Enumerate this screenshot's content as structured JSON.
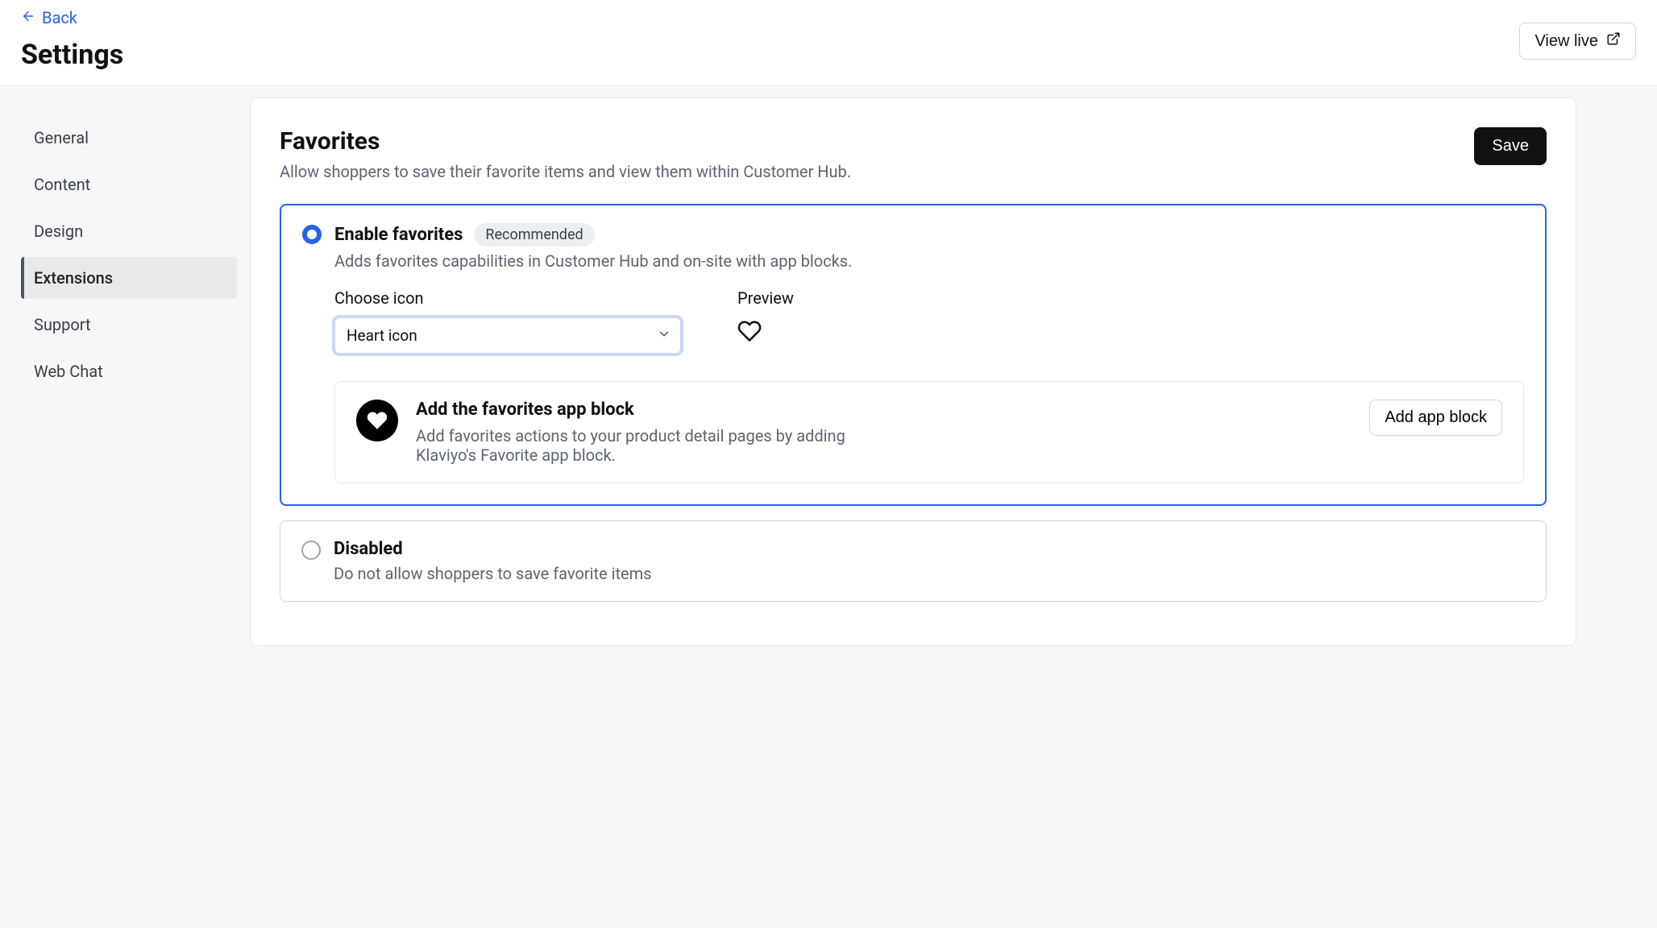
{
  "header": {
    "back_label": "Back",
    "page_title": "Settings",
    "view_live_label": "View live"
  },
  "sidebar": {
    "items": [
      {
        "label": "General",
        "active": false
      },
      {
        "label": "Content",
        "active": false
      },
      {
        "label": "Design",
        "active": false
      },
      {
        "label": "Extensions",
        "active": true
      },
      {
        "label": "Support",
        "active": false
      },
      {
        "label": "Web Chat",
        "active": false
      }
    ]
  },
  "section": {
    "title": "Favorites",
    "subtitle": "Allow shoppers to save their favorite items and view them within Customer Hub.",
    "save_label": "Save"
  },
  "enable_option": {
    "label": "Enable favorites",
    "badge": "Recommended",
    "description": "Adds favorites capabilities in Customer Hub and on-site with app blocks.",
    "choose_icon_label": "Choose icon",
    "selected_icon": "Heart icon",
    "preview_label": "Preview"
  },
  "callout": {
    "title": "Add the favorites app block",
    "description": "Add favorites actions to your product detail pages by adding Klaviyo's Favorite app block.",
    "button_label": "Add app block"
  },
  "disable_option": {
    "label": "Disabled",
    "description": "Do not allow shoppers to save favorite items"
  }
}
